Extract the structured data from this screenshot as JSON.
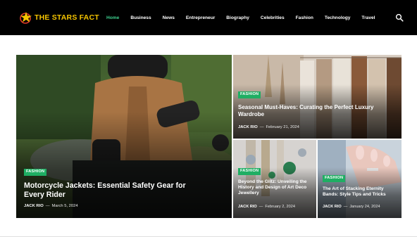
{
  "site": {
    "logo_text": "THE STARS FACT"
  },
  "nav": {
    "items": [
      {
        "label": "Home"
      },
      {
        "label": "Business"
      },
      {
        "label": "News"
      },
      {
        "label": "Entrepreneur"
      },
      {
        "label": "Biography"
      },
      {
        "label": "Celebrities"
      },
      {
        "label": "Fashion"
      },
      {
        "label": "Technology"
      },
      {
        "label": "Travel"
      }
    ],
    "active": "Home"
  },
  "posts": [
    {
      "tag": "FASHION",
      "title": "Motorcycle Jackets: Essential Safety Gear for Every Rider",
      "author": "JACK RIO",
      "date": "March 5, 2024"
    },
    {
      "tag": "FASHION",
      "title": "Seasonal Must-Haves: Curating the Perfect Luxury Wardrobe",
      "author": "JACK RIO",
      "date": "February 21, 2024"
    },
    {
      "tag": "FASHION",
      "title": "Beyond the Glitz: Unveiling the History and Design of Art Deco Jewellery",
      "author": "JACK RIO",
      "date": "February 2, 2024"
    },
    {
      "tag": "FASHION",
      "title": "The Art of Stacking Eternity Bands: Style Tips and Tricks",
      "author": "JACK RIO",
      "date": "January 24, 2024"
    }
  ],
  "meta_separator": "—",
  "colors": {
    "accent": "#1fae63",
    "nav_active": "#3ecf8e",
    "logo": "#f6c500",
    "header_bg": "#000000"
  },
  "icons": {
    "search": "search-icon",
    "logo": "star-logo-icon"
  }
}
